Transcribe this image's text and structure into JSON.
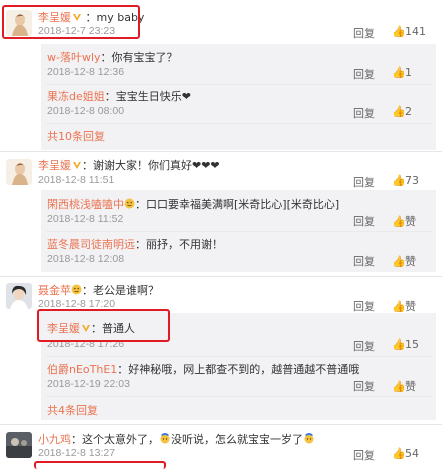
{
  "comments": [
    {
      "author": "李呈媛",
      "text": "my baby",
      "time": "2018-12-7 23:23",
      "reply_label": "回复",
      "likes": "141",
      "replies": [
        {
          "author": "w-落叶wly",
          "text": "你有宝宝了？",
          "time": "2018-12-8 12:36",
          "reply_label": "回复",
          "likes": "1"
        },
        {
          "author": "果冻de姐姐",
          "text": "宝宝生日快乐❤",
          "time": "2018-12-8 08:00",
          "reply_label": "回复",
          "likes": "2"
        }
      ],
      "more_label": "共10条回复"
    },
    {
      "author": "李呈媛",
      "text": "谢谢大家！你们真好❤❤❤",
      "time": "2018-12-8 11:51",
      "reply_label": "回复",
      "likes": "73",
      "replies": [
        {
          "author": "閑西桃浅嗑嗑中",
          "text": "口口要幸福美满啊[米奇比心][米奇比心]",
          "time": "2018-12-8 11:52",
          "reply_label": "回复",
          "likes": "赞"
        },
        {
          "author": "蓝冬晨司徒南明远",
          "text": "丽抒，不用谢！",
          "time": "2018-12-8 12:08",
          "reply_label": "回复",
          "likes": "赞"
        }
      ]
    },
    {
      "author": "聂金苹",
      "text": "老公是谁啊？",
      "time": "2018-12-8 17:20",
      "reply_label": "回复",
      "likes": "赞",
      "replies": [
        {
          "author": "李呈媛",
          "text": "普通人",
          "time": "2018-12-8 17:26",
          "reply_label": "回复",
          "likes": "15"
        },
        {
          "author": "伯爵nEoThE1",
          "text": "好神秘哦，网上都查不到的，越普通越不普通哦",
          "time": "2018-12-19 22:03",
          "reply_label": "回复",
          "likes": "赞"
        }
      ],
      "more_label": "共4条回复"
    },
    {
      "author": "小九鸡",
      "text": "这个太意外了，",
      "text2": "没听说，怎么就宝宝一岁了",
      "time": "2018-12-8 13:27",
      "reply_label": "回复",
      "likes": "54"
    }
  ],
  "colors": {
    "name": "#eb7350",
    "highlight_box": "#e01b24",
    "vip_badge": "#f5a623",
    "reply_bg": "#f2f2f5"
  }
}
